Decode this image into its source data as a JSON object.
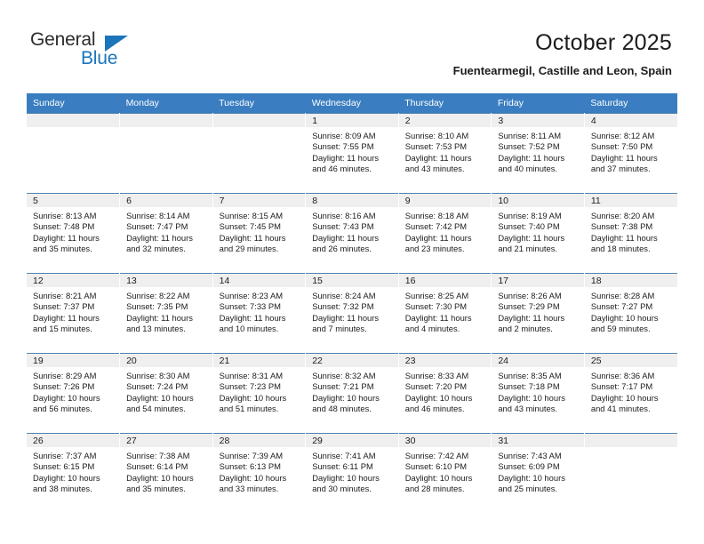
{
  "brand": {
    "word_one": "General",
    "word_two": "Blue",
    "triangle_icon": "triangle-icon",
    "accent_color": "#1b75bb"
  },
  "header": {
    "title": "October 2025",
    "subtitle": "Fuentearmegil, Castille and Leon, Spain"
  },
  "theme": {
    "header_row_bg": "#3a7dc0",
    "daynum_bg": "#efefef",
    "grid_line": "#4a80b5",
    "text": "#1c1c1c"
  },
  "weekdays": [
    "Sunday",
    "Monday",
    "Tuesday",
    "Wednesday",
    "Thursday",
    "Friday",
    "Saturday"
  ],
  "weeks": [
    [
      {
        "day": "",
        "empty": true
      },
      {
        "day": "",
        "empty": true
      },
      {
        "day": "",
        "empty": true
      },
      {
        "day": "1",
        "sunrise": "Sunrise: 8:09 AM",
        "sunset": "Sunset: 7:55 PM",
        "daylight_1": "Daylight: 11 hours",
        "daylight_2": "and 46 minutes."
      },
      {
        "day": "2",
        "sunrise": "Sunrise: 8:10 AM",
        "sunset": "Sunset: 7:53 PM",
        "daylight_1": "Daylight: 11 hours",
        "daylight_2": "and 43 minutes."
      },
      {
        "day": "3",
        "sunrise": "Sunrise: 8:11 AM",
        "sunset": "Sunset: 7:52 PM",
        "daylight_1": "Daylight: 11 hours",
        "daylight_2": "and 40 minutes."
      },
      {
        "day": "4",
        "sunrise": "Sunrise: 8:12 AM",
        "sunset": "Sunset: 7:50 PM",
        "daylight_1": "Daylight: 11 hours",
        "daylight_2": "and 37 minutes."
      }
    ],
    [
      {
        "day": "5",
        "sunrise": "Sunrise: 8:13 AM",
        "sunset": "Sunset: 7:48 PM",
        "daylight_1": "Daylight: 11 hours",
        "daylight_2": "and 35 minutes."
      },
      {
        "day": "6",
        "sunrise": "Sunrise: 8:14 AM",
        "sunset": "Sunset: 7:47 PM",
        "daylight_1": "Daylight: 11 hours",
        "daylight_2": "and 32 minutes."
      },
      {
        "day": "7",
        "sunrise": "Sunrise: 8:15 AM",
        "sunset": "Sunset: 7:45 PM",
        "daylight_1": "Daylight: 11 hours",
        "daylight_2": "and 29 minutes."
      },
      {
        "day": "8",
        "sunrise": "Sunrise: 8:16 AM",
        "sunset": "Sunset: 7:43 PM",
        "daylight_1": "Daylight: 11 hours",
        "daylight_2": "and 26 minutes."
      },
      {
        "day": "9",
        "sunrise": "Sunrise: 8:18 AM",
        "sunset": "Sunset: 7:42 PM",
        "daylight_1": "Daylight: 11 hours",
        "daylight_2": "and 23 minutes."
      },
      {
        "day": "10",
        "sunrise": "Sunrise: 8:19 AM",
        "sunset": "Sunset: 7:40 PM",
        "daylight_1": "Daylight: 11 hours",
        "daylight_2": "and 21 minutes."
      },
      {
        "day": "11",
        "sunrise": "Sunrise: 8:20 AM",
        "sunset": "Sunset: 7:38 PM",
        "daylight_1": "Daylight: 11 hours",
        "daylight_2": "and 18 minutes."
      }
    ],
    [
      {
        "day": "12",
        "sunrise": "Sunrise: 8:21 AM",
        "sunset": "Sunset: 7:37 PM",
        "daylight_1": "Daylight: 11 hours",
        "daylight_2": "and 15 minutes."
      },
      {
        "day": "13",
        "sunrise": "Sunrise: 8:22 AM",
        "sunset": "Sunset: 7:35 PM",
        "daylight_1": "Daylight: 11 hours",
        "daylight_2": "and 13 minutes."
      },
      {
        "day": "14",
        "sunrise": "Sunrise: 8:23 AM",
        "sunset": "Sunset: 7:33 PM",
        "daylight_1": "Daylight: 11 hours",
        "daylight_2": "and 10 minutes."
      },
      {
        "day": "15",
        "sunrise": "Sunrise: 8:24 AM",
        "sunset": "Sunset: 7:32 PM",
        "daylight_1": "Daylight: 11 hours",
        "daylight_2": "and 7 minutes."
      },
      {
        "day": "16",
        "sunrise": "Sunrise: 8:25 AM",
        "sunset": "Sunset: 7:30 PM",
        "daylight_1": "Daylight: 11 hours",
        "daylight_2": "and 4 minutes."
      },
      {
        "day": "17",
        "sunrise": "Sunrise: 8:26 AM",
        "sunset": "Sunset: 7:29 PM",
        "daylight_1": "Daylight: 11 hours",
        "daylight_2": "and 2 minutes."
      },
      {
        "day": "18",
        "sunrise": "Sunrise: 8:28 AM",
        "sunset": "Sunset: 7:27 PM",
        "daylight_1": "Daylight: 10 hours",
        "daylight_2": "and 59 minutes."
      }
    ],
    [
      {
        "day": "19",
        "sunrise": "Sunrise: 8:29 AM",
        "sunset": "Sunset: 7:26 PM",
        "daylight_1": "Daylight: 10 hours",
        "daylight_2": "and 56 minutes."
      },
      {
        "day": "20",
        "sunrise": "Sunrise: 8:30 AM",
        "sunset": "Sunset: 7:24 PM",
        "daylight_1": "Daylight: 10 hours",
        "daylight_2": "and 54 minutes."
      },
      {
        "day": "21",
        "sunrise": "Sunrise: 8:31 AM",
        "sunset": "Sunset: 7:23 PM",
        "daylight_1": "Daylight: 10 hours",
        "daylight_2": "and 51 minutes."
      },
      {
        "day": "22",
        "sunrise": "Sunrise: 8:32 AM",
        "sunset": "Sunset: 7:21 PM",
        "daylight_1": "Daylight: 10 hours",
        "daylight_2": "and 48 minutes."
      },
      {
        "day": "23",
        "sunrise": "Sunrise: 8:33 AM",
        "sunset": "Sunset: 7:20 PM",
        "daylight_1": "Daylight: 10 hours",
        "daylight_2": "and 46 minutes."
      },
      {
        "day": "24",
        "sunrise": "Sunrise: 8:35 AM",
        "sunset": "Sunset: 7:18 PM",
        "daylight_1": "Daylight: 10 hours",
        "daylight_2": "and 43 minutes."
      },
      {
        "day": "25",
        "sunrise": "Sunrise: 8:36 AM",
        "sunset": "Sunset: 7:17 PM",
        "daylight_1": "Daylight: 10 hours",
        "daylight_2": "and 41 minutes."
      }
    ],
    [
      {
        "day": "26",
        "sunrise": "Sunrise: 7:37 AM",
        "sunset": "Sunset: 6:15 PM",
        "daylight_1": "Daylight: 10 hours",
        "daylight_2": "and 38 minutes."
      },
      {
        "day": "27",
        "sunrise": "Sunrise: 7:38 AM",
        "sunset": "Sunset: 6:14 PM",
        "daylight_1": "Daylight: 10 hours",
        "daylight_2": "and 35 minutes."
      },
      {
        "day": "28",
        "sunrise": "Sunrise: 7:39 AM",
        "sunset": "Sunset: 6:13 PM",
        "daylight_1": "Daylight: 10 hours",
        "daylight_2": "and 33 minutes."
      },
      {
        "day": "29",
        "sunrise": "Sunrise: 7:41 AM",
        "sunset": "Sunset: 6:11 PM",
        "daylight_1": "Daylight: 10 hours",
        "daylight_2": "and 30 minutes."
      },
      {
        "day": "30",
        "sunrise": "Sunrise: 7:42 AM",
        "sunset": "Sunset: 6:10 PM",
        "daylight_1": "Daylight: 10 hours",
        "daylight_2": "and 28 minutes."
      },
      {
        "day": "31",
        "sunrise": "Sunrise: 7:43 AM",
        "sunset": "Sunset: 6:09 PM",
        "daylight_1": "Daylight: 10 hours",
        "daylight_2": "and 25 minutes."
      },
      {
        "day": "",
        "empty": true
      }
    ]
  ]
}
